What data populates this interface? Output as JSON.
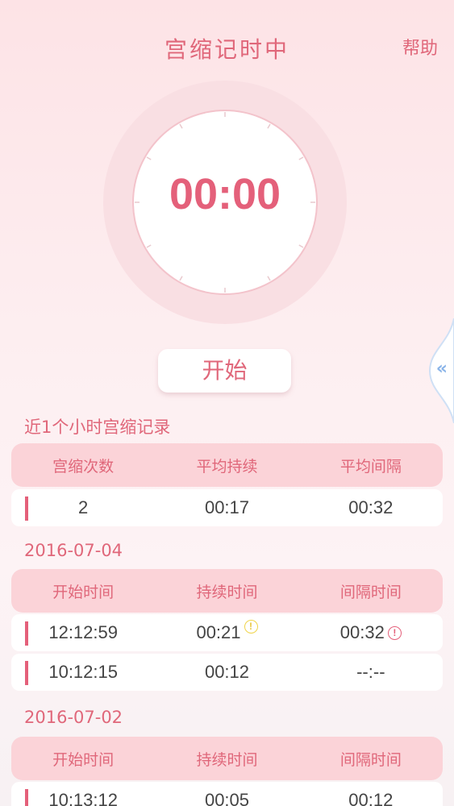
{
  "header": {
    "title": "宫缩记时中",
    "help_label": "帮助"
  },
  "timer": {
    "value": "00:00"
  },
  "start_button": {
    "label": "开始"
  },
  "side_tab": {
    "arrow": "«"
  },
  "summary": {
    "label": "近1个小时宫缩记录",
    "columns": [
      "宫缩次数",
      "平均持续",
      "平均间隔"
    ],
    "row": [
      "2",
      "00:17",
      "00:32"
    ]
  },
  "groups": [
    {
      "date": "2016-07-04",
      "columns": [
        "开始时间",
        "持续时间",
        "间隔时间"
      ],
      "rows": [
        [
          "12:12:59",
          "00:21",
          "00:32"
        ],
        [
          "10:12:15",
          "00:12",
          "--:--"
        ]
      ]
    },
    {
      "date": "2016-07-02",
      "columns": [
        "开始时间",
        "持续时间",
        "间隔时间"
      ],
      "rows": [
        [
          "10:13:12",
          "00:05",
          "00:12"
        ]
      ]
    }
  ],
  "icons": {
    "warning": "!"
  },
  "colors": {
    "accent": "#e0677a",
    "header_bg": "#fbd3d8",
    "ring": "#f9dfe3",
    "side_arrow": "#8ab4e8"
  }
}
